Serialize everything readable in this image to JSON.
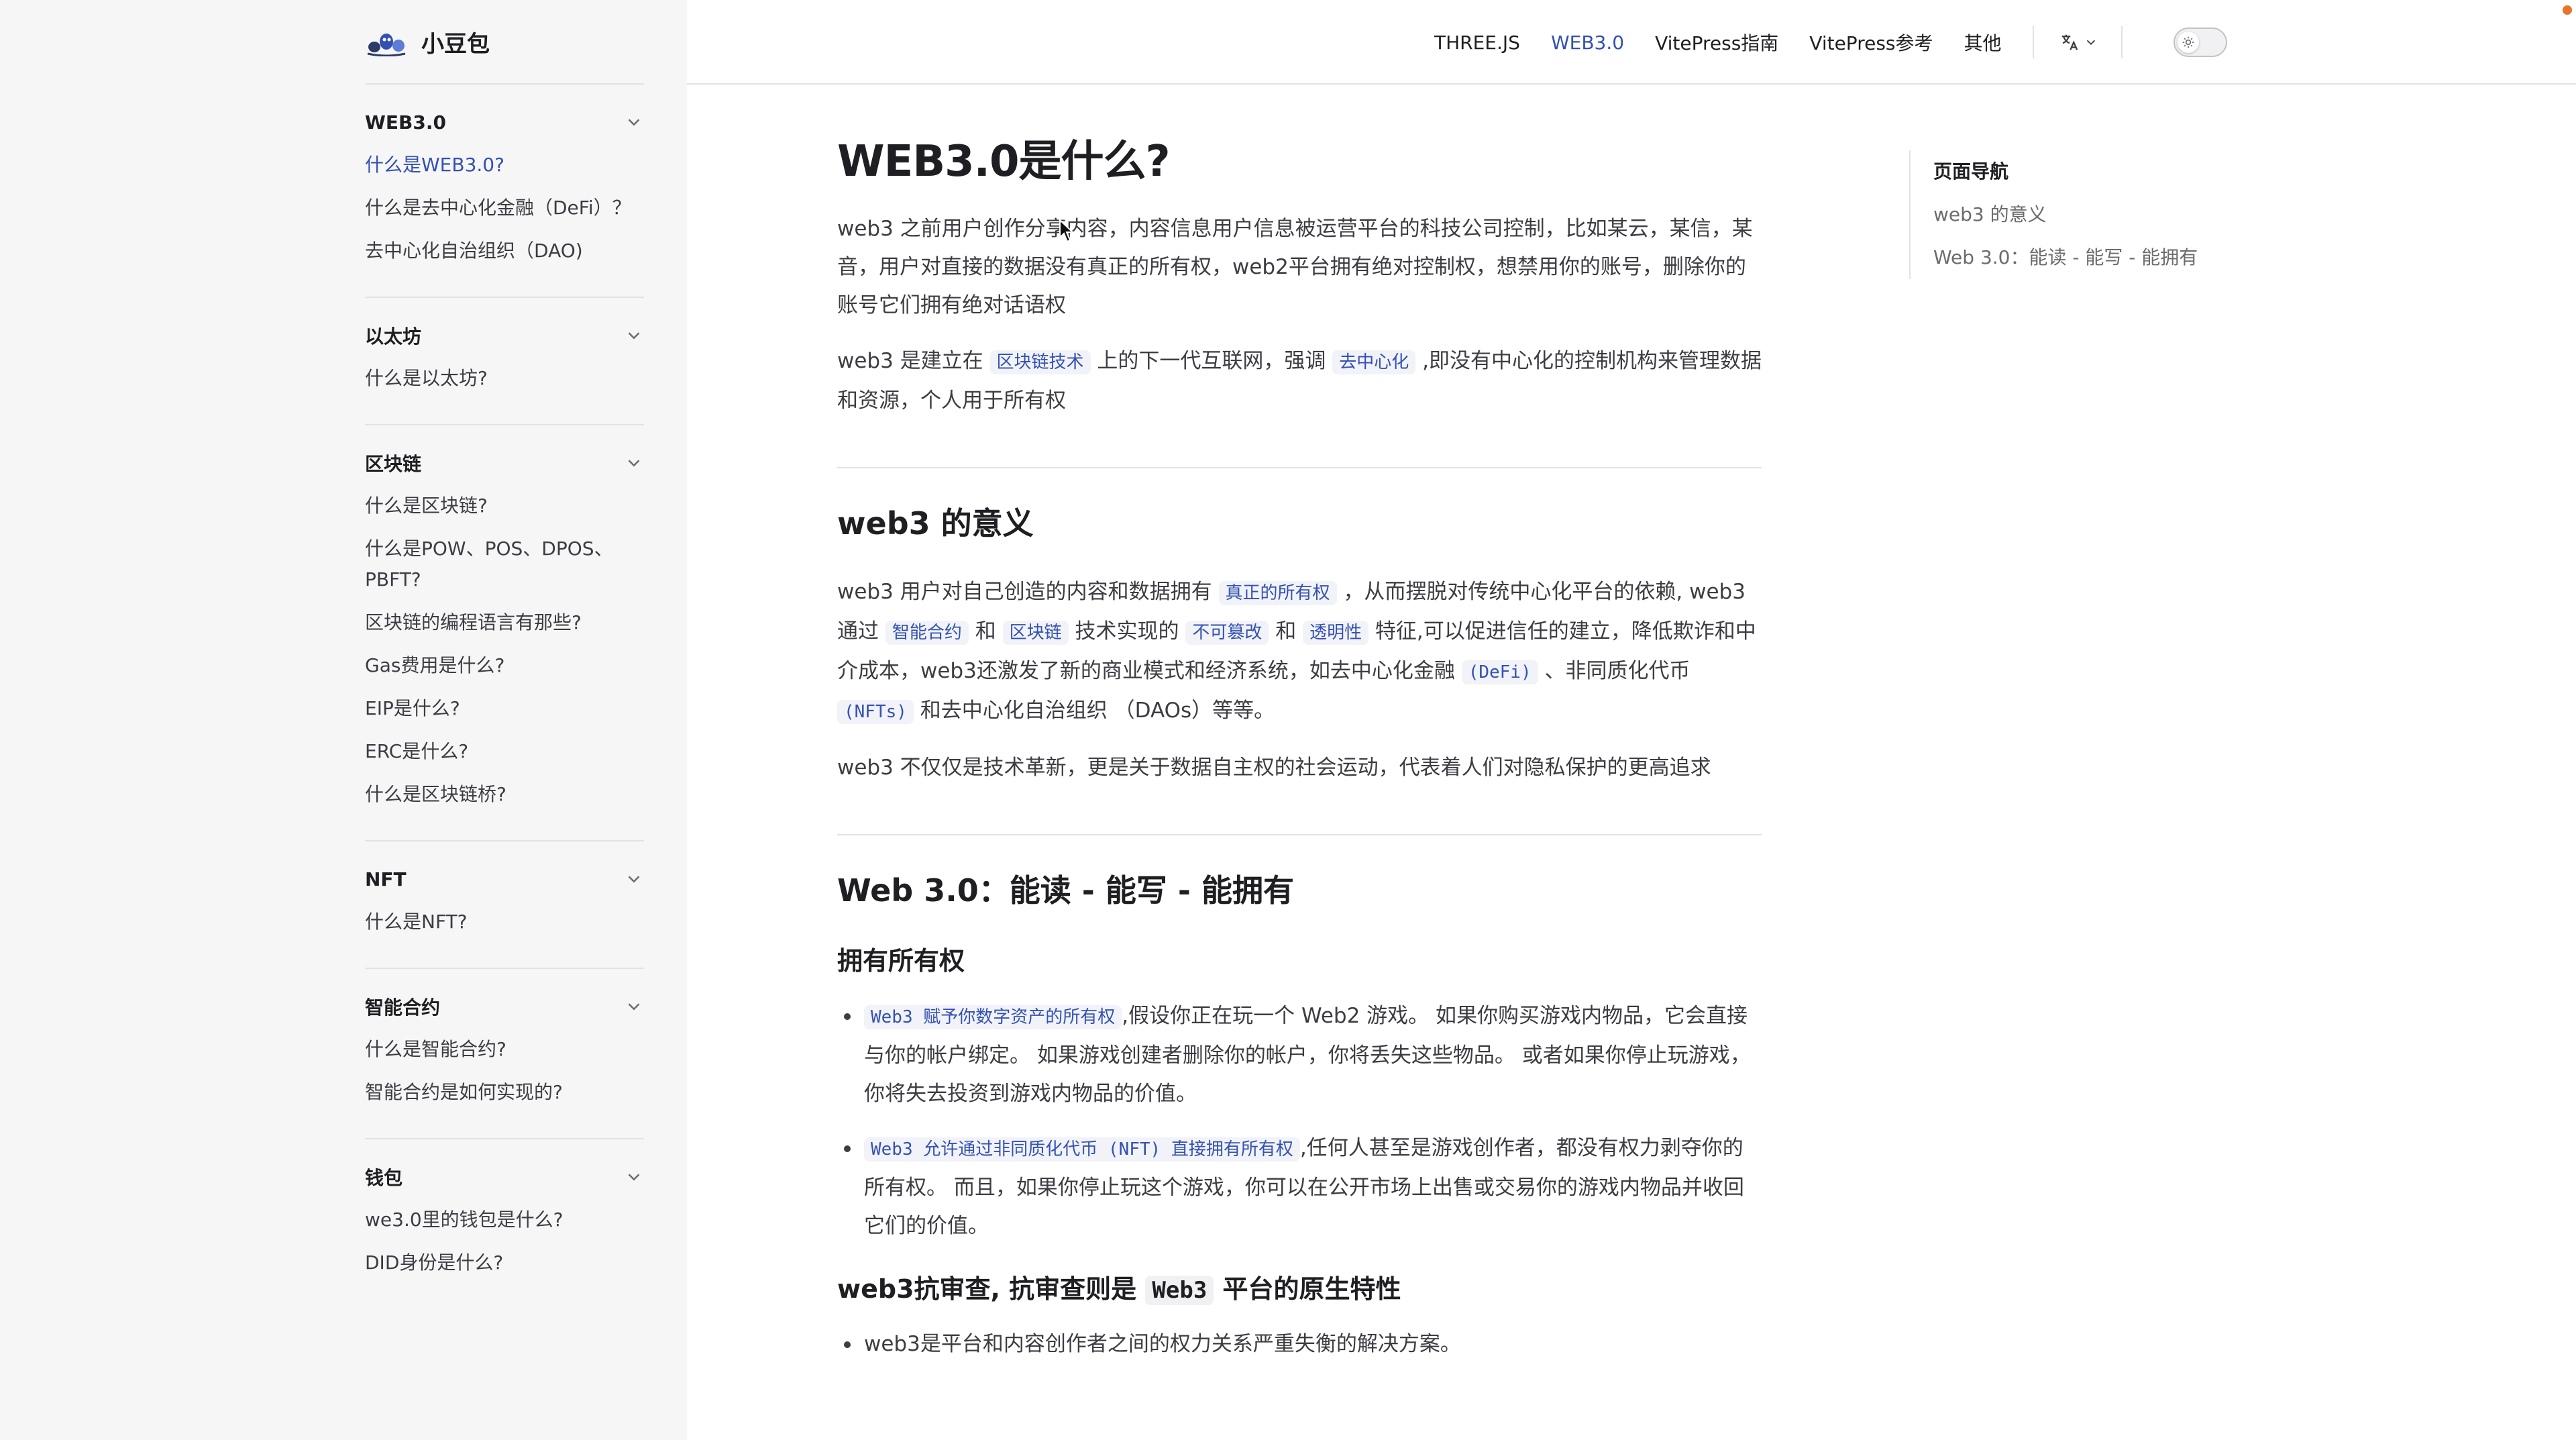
{
  "brand": {
    "name": "小豆包",
    "logo_icon": "bean-logo-icon"
  },
  "top_nav": {
    "links": [
      {
        "label": "THREE.JS",
        "active": false
      },
      {
        "label": "WEB3.0",
        "active": true
      },
      {
        "label": "VitePress指南",
        "active": false
      },
      {
        "label": "VitePress参考",
        "active": false
      },
      {
        "label": "其他",
        "active": false
      }
    ],
    "language_icon": "translate-icon",
    "theme_icon": "sun-icon"
  },
  "sidebar": {
    "groups": [
      {
        "title": "WEB3.0",
        "items": [
          "什么是WEB3.0?",
          "什么是去中心化金融（DeFi）？",
          "去中心化自治组织（DAO)"
        ]
      },
      {
        "title": "以太坊",
        "items": [
          "什么是以太坊?"
        ]
      },
      {
        "title": "区块链",
        "items": [
          "什么是区块链?",
          "什么是POW、POS、DPOS、PBFT?",
          "区块链的编程语言有那些?",
          "Gas费用是什么?",
          "EIP是什么?",
          "ERC是什么?",
          "什么是区块链桥?"
        ]
      },
      {
        "title": "NFT",
        "items": [
          "什么是NFT?"
        ]
      },
      {
        "title": "智能合约",
        "items": [
          "什么是智能合约?",
          "智能合约是如何实现的?"
        ]
      },
      {
        "title": "钱包",
        "items": [
          "we3.0里的钱包是什么?",
          "DID身份是什么?"
        ]
      }
    ],
    "active_item": "什么是WEB3.0?"
  },
  "article": {
    "title": "WEB3.0是什么?",
    "p1": "web3 之前用户创作分享内容，内容信息用户信息被运营平台的科技公司控制，比如某云，某信，某音，用户对直接的数据没有真正的所有权，web2平台拥有绝对控制权，想禁用你的账号，删除你的账号它们拥有绝对话语权",
    "p2": {
      "t1": "web3 是建立在",
      "c1": "区块链技术",
      "t2": "上的下一代互联网，强调",
      "c2": "去中心化",
      "t3": ",即没有中心化的控制机构来管理数据和资源，个人用于所有权"
    },
    "s1": {
      "heading": "web3 的意义",
      "p1": {
        "t1": "web3 用户对自己创造的内容和数据拥有",
        "c1": "真正的所有权",
        "t2": "，从而摆脱对传统中心化平台的依赖, web3 通过",
        "c2": "智能合约",
        "t3": "和",
        "c3": "区块链",
        "t4": "技术实现的",
        "c4": "不可篡改",
        "t5": "和",
        "c5": "透明性",
        "t6": "特征,可以促进信任的建立，降低欺诈和中介成本，web3还激发了新的商业模式和经济系统，如去中心化金融",
        "c6": "(DeFi)",
        "t7": "、非同质化代币",
        "c7": "(NFTs)",
        "t8": "和去中心化自治组织 （DAOs）等等。"
      },
      "p2": "web3 不仅仅是技术革新，更是关于数据自主权的社会运动，代表着人们对隐私保护的更高追求"
    },
    "s2": {
      "heading": "Web 3.0：能读 - 能写 - 能拥有",
      "sub1": "拥有所有权",
      "li1": {
        "c": "Web3 赋予你数字资产的所有权",
        "t": ",假设你正在玩一个 Web2 游戏。 如果你购买游戏内物品，它会直接与你的帐户绑定。 如果游戏创建者删除你的帐户，你将丢失这些物品。 或者如果你停止玩游戏，你将失去投资到游戏内物品的价值。"
      },
      "li2": {
        "c": "Web3 允许通过非同质化代币 (NFT) 直接拥有所有权",
        "t": ",任何人甚至是游戏创作者，都没有权力剥夺你的所有权。 而且，如果你停止玩这个游戏，你可以在公开市场上出售或交易你的游戏内物品并收回它们的价值。"
      },
      "sub2": {
        "t1": "web3抗审查, 抗审查则是",
        "c": "Web3",
        "t2": "平台的原生特性"
      },
      "li3": "web3是平台和内容创作者之间的权力关系严重失衡的解决方案。"
    }
  },
  "outline": {
    "title": "页面导航",
    "links": [
      "web3 的意义",
      "Web 3.0：能读 - 能写 - 能拥有"
    ]
  },
  "colors": {
    "accent": "#3451b2",
    "sidebar_bg": "#f6f6f7",
    "text": "#3c3c43",
    "heading": "#1f1f23",
    "divider": "#e2e2e3"
  }
}
